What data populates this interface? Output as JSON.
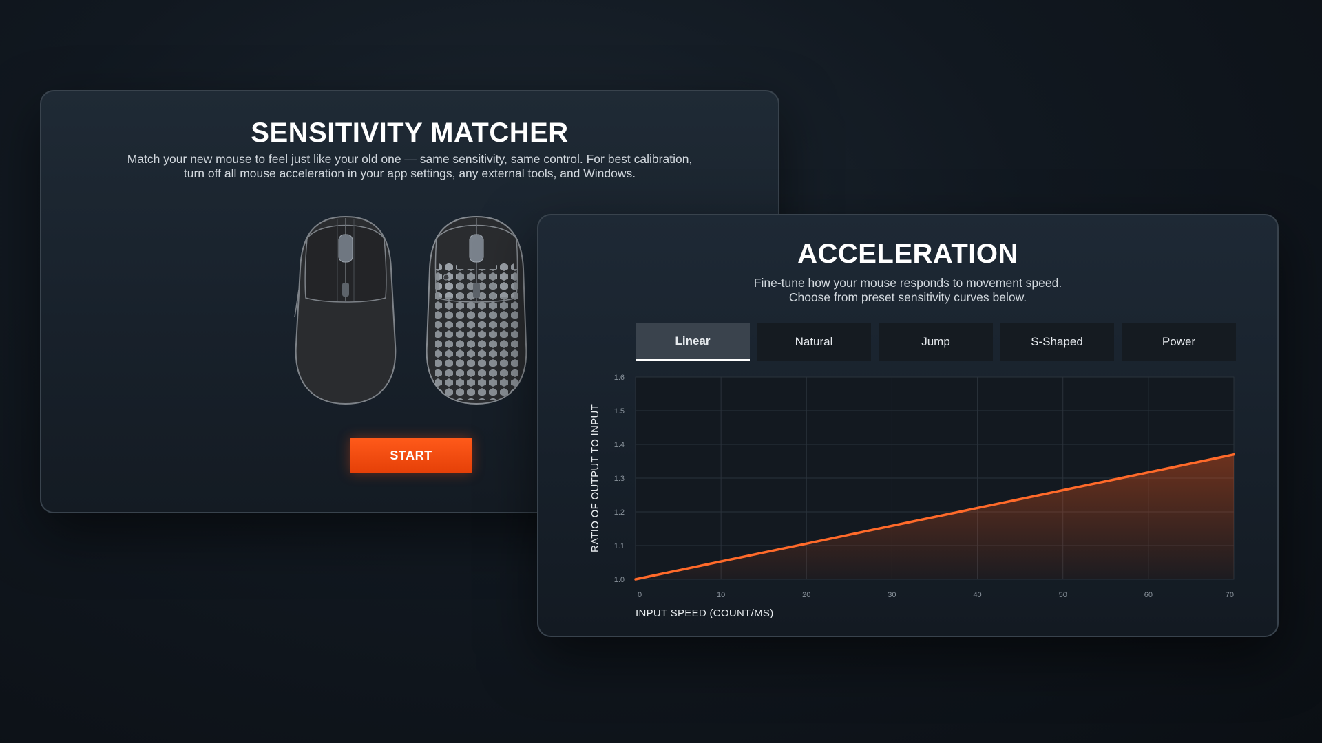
{
  "matcher": {
    "title": "SENSITIVITY MATCHER",
    "description_line1": "Match your new mouse to feel just like your old one — same sensitivity, same control. For best calibration,",
    "description_line2": "turn off all mouse acceleration in your app settings, any external tools, and Windows.",
    "start_label": "START"
  },
  "acceleration": {
    "title": "ACCELERATION",
    "description_line1": "Fine-tune how your mouse responds to movement speed.",
    "description_line2": "Choose from preset sensitivity curves below.",
    "tabs": [
      {
        "label": "Linear",
        "active": true
      },
      {
        "label": "Natural",
        "active": false
      },
      {
        "label": "Jump",
        "active": false
      },
      {
        "label": "S-Shaped",
        "active": false
      },
      {
        "label": "Power",
        "active": false
      }
    ]
  },
  "colors": {
    "accent": "#ff5a1a",
    "curve": "#ff6a2a",
    "panel_border": "#39434d"
  },
  "chart_data": {
    "type": "area",
    "xlabel": "INPUT SPEED (COUNT/MS)",
    "ylabel": "RATIO OF OUTPUT TO INPUT",
    "x_ticks": [
      "0",
      "10",
      "20",
      "30",
      "40",
      "50",
      "60",
      "70"
    ],
    "y_ticks": [
      "1.0",
      "1.1",
      "1.2",
      "1.3",
      "1.4",
      "1.5",
      "1.6"
    ],
    "xlim": [
      0,
      70
    ],
    "ylim": [
      1.0,
      1.6
    ],
    "grid": true,
    "series": [
      {
        "x": [
          0,
          70
        ],
        "values": [
          1.0,
          1.37
        ]
      }
    ]
  }
}
